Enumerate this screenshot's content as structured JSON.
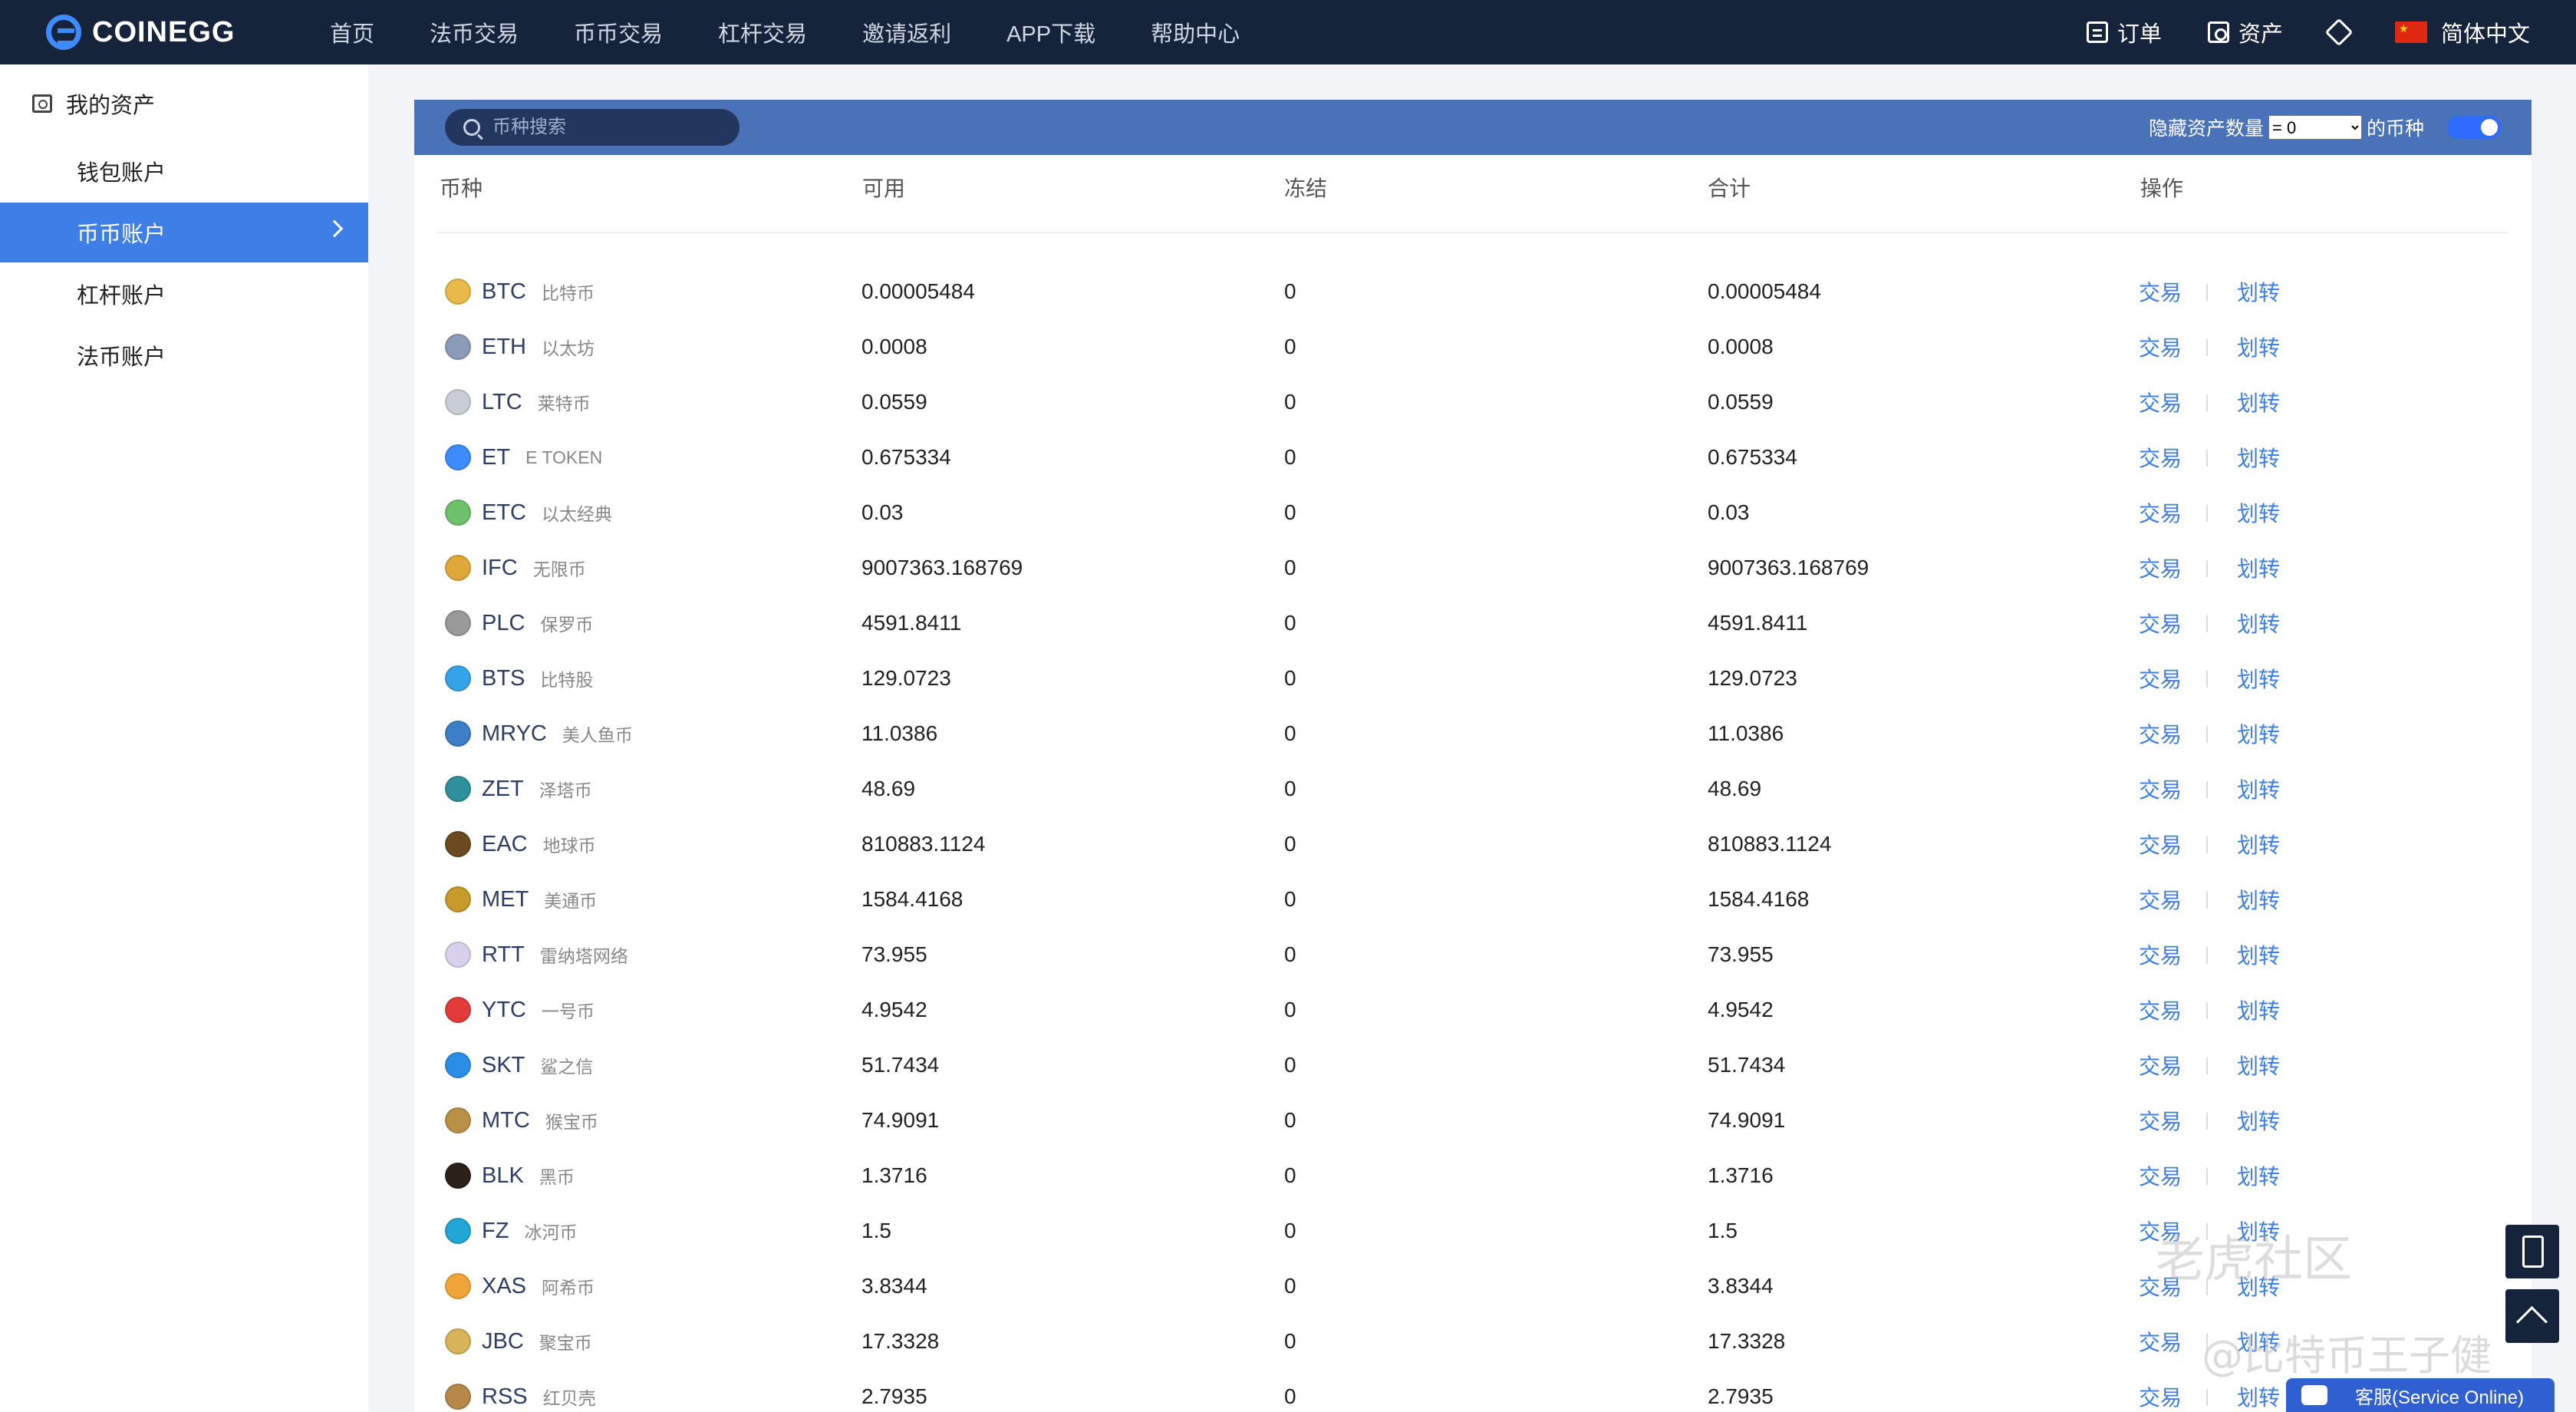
{
  "brand": {
    "name": "COINEGG",
    "accent": "#3d8bff",
    "nav_bg": "#16243b"
  },
  "nav": [
    "首页",
    "法币交易",
    "币币交易",
    "杠杆交易",
    "邀请返利",
    "APP下载",
    "帮助中心"
  ],
  "topright": {
    "orders": "订单",
    "assets": "资产",
    "language": "简体中文"
  },
  "sidebar": {
    "title": "我的资产",
    "items": [
      {
        "label": "钱包账户",
        "active": false
      },
      {
        "label": "币币账户",
        "active": true
      },
      {
        "label": "杠杆账户",
        "active": false
      },
      {
        "label": "法币账户",
        "active": false
      }
    ]
  },
  "toolbar": {
    "search_placeholder": "币种搜索",
    "hide_label": "隐藏资产数量",
    "hide_value": "= 0",
    "hide_suffix": "的币种"
  },
  "table": {
    "headers": [
      "币种",
      "可用",
      "冻结",
      "合计",
      "操作"
    ],
    "action_trade": "交易",
    "action_transfer": "划转",
    "rows": [
      {
        "symbol": "BTC",
        "name": "比特币",
        "available": "0.00005484",
        "frozen": "0",
        "total": "0.00005484",
        "color": "#e9b949"
      },
      {
        "symbol": "ETH",
        "name": "以太坊",
        "available": "0.0008",
        "frozen": "0",
        "total": "0.0008",
        "color": "#8c9bb8"
      },
      {
        "symbol": "LTC",
        "name": "莱特币",
        "available": "0.0559",
        "frozen": "0",
        "total": "0.0559",
        "color": "#c9ced6"
      },
      {
        "symbol": "ET",
        "name": "E TOKEN",
        "available": "0.675334",
        "frozen": "0",
        "total": "0.675334",
        "color": "#3d8bff"
      },
      {
        "symbol": "ETC",
        "name": "以太经典",
        "available": "0.03",
        "frozen": "0",
        "total": "0.03",
        "color": "#6fc06a"
      },
      {
        "symbol": "IFC",
        "name": "无限币",
        "available": "9007363.168769",
        "frozen": "0",
        "total": "9007363.168769",
        "color": "#e0a83a"
      },
      {
        "symbol": "PLC",
        "name": "保罗币",
        "available": "4591.8411",
        "frozen": "0",
        "total": "4591.8411",
        "color": "#9a9a9a"
      },
      {
        "symbol": "BTS",
        "name": "比特股",
        "available": "129.0723",
        "frozen": "0",
        "total": "129.0723",
        "color": "#35a3e8"
      },
      {
        "symbol": "MRYC",
        "name": "美人鱼币",
        "available": "11.0386",
        "frozen": "0",
        "total": "11.0386",
        "color": "#3c7ec8"
      },
      {
        "symbol": "ZET",
        "name": "泽塔币",
        "available": "48.69",
        "frozen": "0",
        "total": "48.69",
        "color": "#2f8f9a"
      },
      {
        "symbol": "EAC",
        "name": "地球币",
        "available": "810883.1124",
        "frozen": "0",
        "total": "810883.1124",
        "color": "#6b4a1f"
      },
      {
        "symbol": "MET",
        "name": "美通币",
        "available": "1584.4168",
        "frozen": "0",
        "total": "1584.4168",
        "color": "#c79a2c"
      },
      {
        "symbol": "RTT",
        "name": "雷纳塔网络",
        "available": "73.955",
        "frozen": "0",
        "total": "73.955",
        "color": "#d9d0ec"
      },
      {
        "symbol": "YTC",
        "name": "一号币",
        "available": "4.9542",
        "frozen": "0",
        "total": "4.9542",
        "color": "#e23a3a"
      },
      {
        "symbol": "SKT",
        "name": "鲨之信",
        "available": "51.7434",
        "frozen": "0",
        "total": "51.7434",
        "color": "#2a8ee6"
      },
      {
        "symbol": "MTC",
        "name": "猴宝币",
        "available": "74.9091",
        "frozen": "0",
        "total": "74.9091",
        "color": "#b99146"
      },
      {
        "symbol": "BLK",
        "name": "黑币",
        "available": "1.3716",
        "frozen": "0",
        "total": "1.3716",
        "color": "#2b2118"
      },
      {
        "symbol": "FZ",
        "name": "冰河币",
        "available": "1.5",
        "frozen": "0",
        "total": "1.5",
        "color": "#22a6d6"
      },
      {
        "symbol": "XAS",
        "name": "阿希币",
        "available": "3.8344",
        "frozen": "0",
        "total": "3.8344",
        "color": "#f0a53a"
      },
      {
        "symbol": "JBC",
        "name": "聚宝币",
        "available": "17.3328",
        "frozen": "0",
        "total": "17.3328",
        "color": "#d9b35a"
      },
      {
        "symbol": "RSS",
        "name": "红贝壳",
        "available": "2.7935",
        "frozen": "0",
        "total": "2.7935",
        "color": "#b6884a"
      }
    ]
  },
  "support": {
    "label": "客服(Service Online)"
  },
  "watermark": {
    "line1": "老虎社区",
    "line2": "@比特币王子健"
  }
}
